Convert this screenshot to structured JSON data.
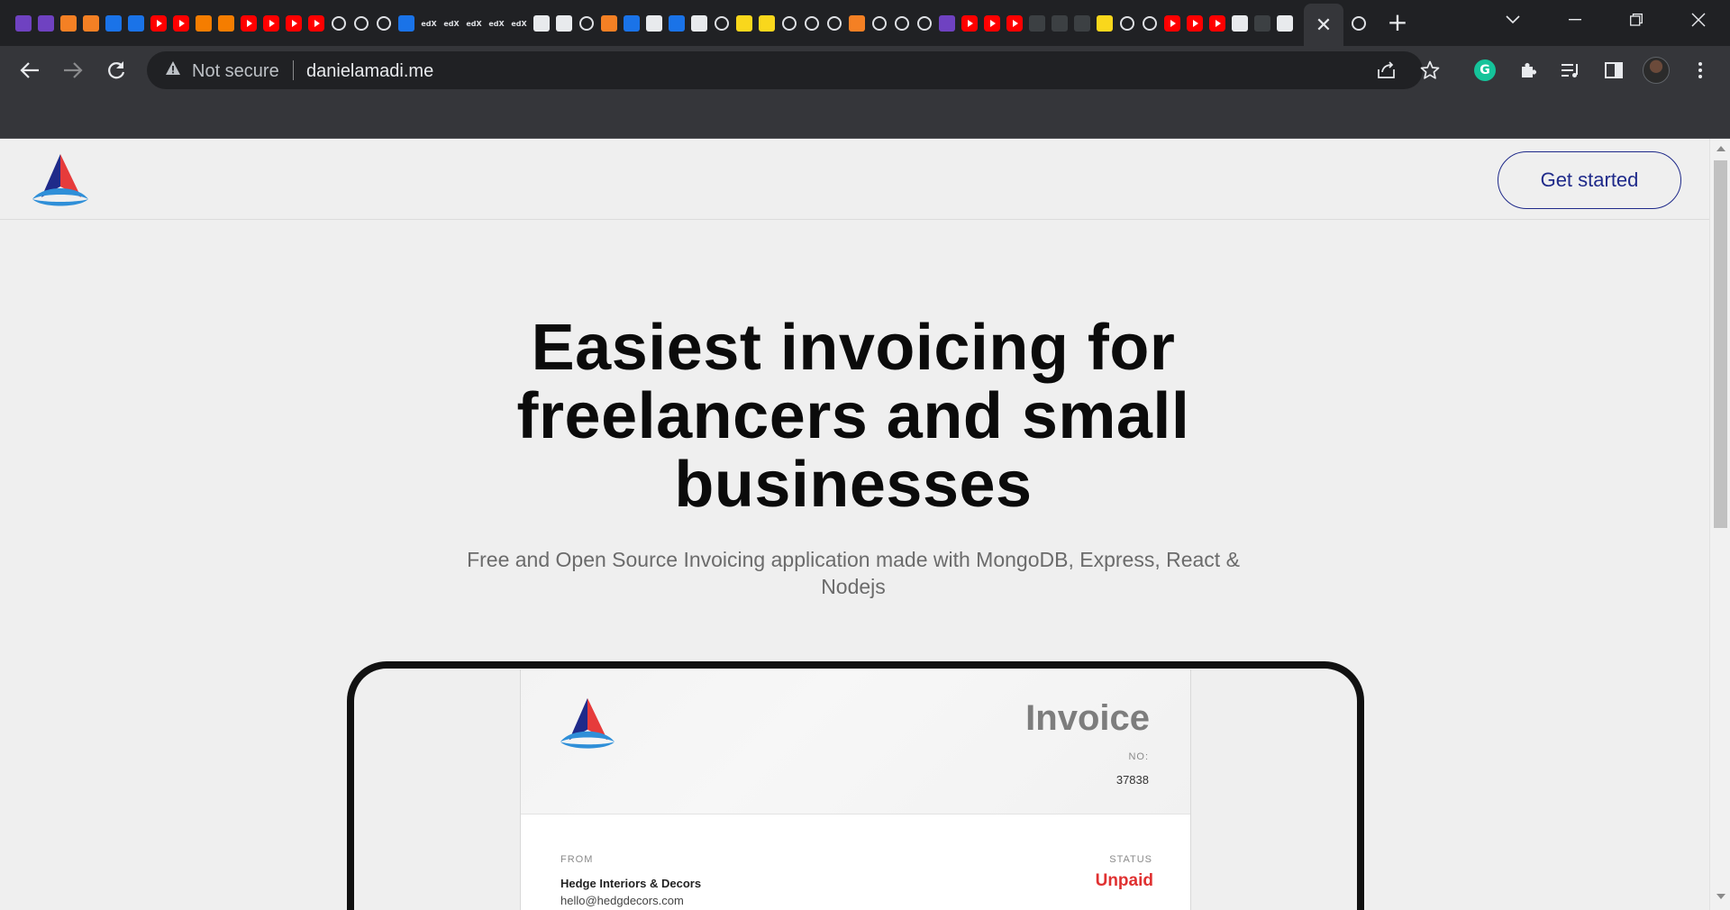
{
  "browser": {
    "tab_favicons": [
      "extension-icon",
      "extension-icon",
      "box-icon",
      "box-icon",
      "shield-icon",
      "kubernetes-icon",
      "youtube-icon",
      "youtube-icon",
      "blogger-icon",
      "blogger-icon",
      "youtube-icon",
      "youtube-icon",
      "youtube-icon",
      "youtube-icon",
      "github-icon",
      "github-icon",
      "github-icon",
      "linkedin-learning-icon",
      "edx-icon",
      "edx-icon",
      "edx-icon",
      "edx-icon",
      "edx-icon",
      "chrome-icon",
      "book-icon",
      "github-icon",
      "stackoverflow-icon",
      "docs-icon",
      "medium-icon",
      "docs-icon",
      "chart-icon",
      "github-icon",
      "sheets-icon",
      "slides-icon",
      "github-icon",
      "github-icon",
      "github-icon",
      "g-icon",
      "github-icon",
      "github-icon",
      "github-icon",
      "canva-icon",
      "youtube-icon",
      "youtube-icon",
      "youtube-icon",
      "netlify-icon",
      "landscape-icon",
      "play-icon",
      "pikachu-icon",
      "github-icon",
      "github-icon",
      "youtube-icon",
      "youtube-icon",
      "youtube-icon",
      "c-icon",
      "circle-icon",
      "avatar-icon"
    ],
    "edx_text": "edX",
    "active_tab_close": "✕",
    "new_tab": "+",
    "omnibox": {
      "security_label": "Not secure",
      "url": "danielamadi.me"
    },
    "grammarly_letter": "G",
    "colors": {
      "chrome_dark": "#202124",
      "toolbar": "#35363a",
      "grammarly": "#15c39a"
    }
  },
  "page": {
    "header": {
      "cta_label": "Get started"
    },
    "hero": {
      "title": "Easiest invoicing for freelancers and small businesses",
      "subtitle": "Free and Open Source Invoicing application made with MongoDB, Express, React & Nodejs"
    },
    "invoice_preview": {
      "title": "Invoice",
      "number_label": "NO:",
      "number": "37838",
      "from_label": "FROM",
      "from_name": "Hedge Interiors & Decors",
      "from_email": "hello@hedgdecors.com",
      "status_label": "STATUS",
      "status": "Unpaid",
      "colors": {
        "status": "#e03131",
        "cta": "#1f2a8a"
      }
    }
  }
}
